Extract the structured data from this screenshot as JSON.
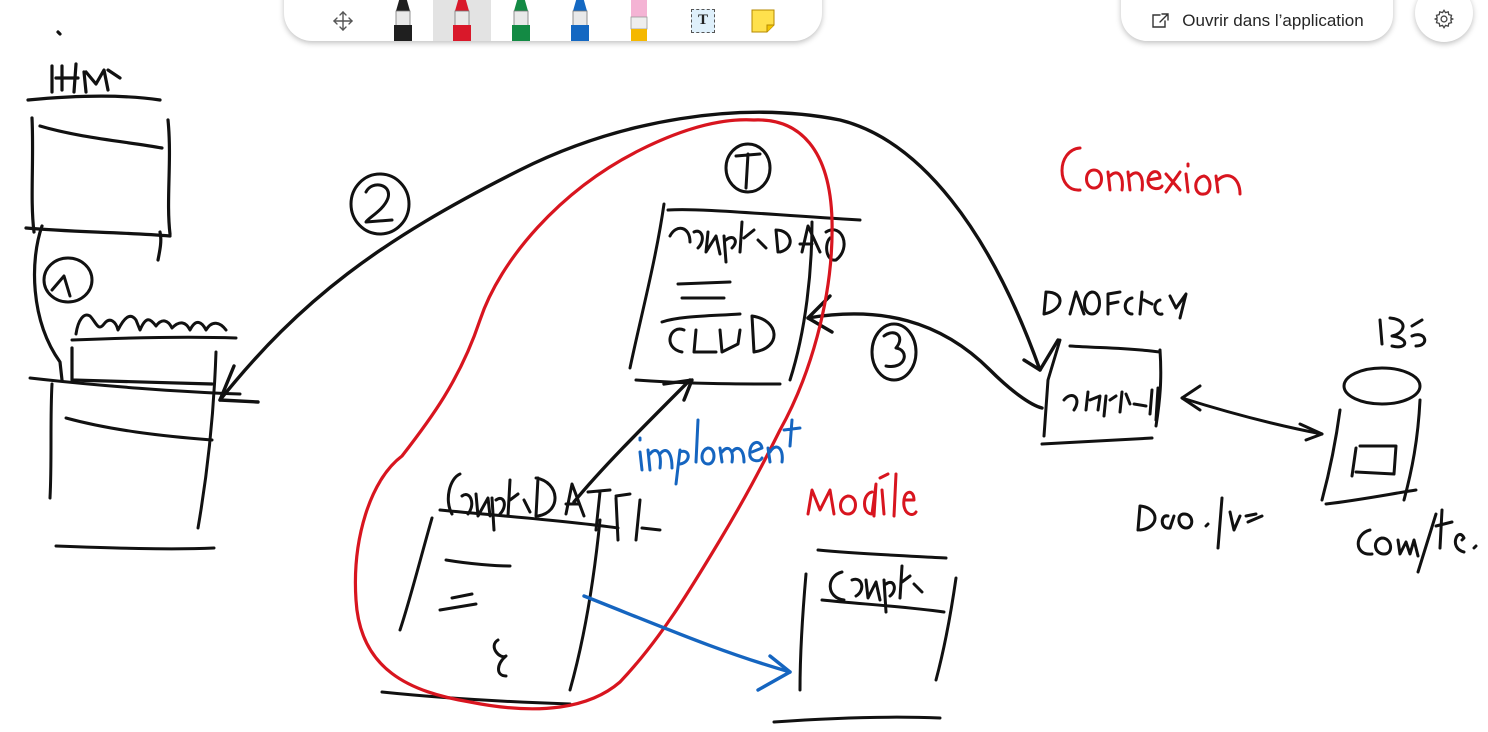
{
  "toolbar": {
    "tools": [
      {
        "name": "move-tool",
        "icon": "move-icon"
      },
      {
        "name": "pen-black",
        "icon": "pen-icon",
        "color": "#1f1f1f",
        "selected": false
      },
      {
        "name": "pen-red",
        "icon": "pen-icon",
        "color": "#d9182a",
        "selected": true
      },
      {
        "name": "pen-green",
        "icon": "pen-icon",
        "color": "#138a44",
        "selected": false
      },
      {
        "name": "pen-blue",
        "icon": "pen-icon",
        "color": "#1468c2",
        "selected": false
      },
      {
        "name": "highlighter-pink",
        "icon": "highlighter-icon",
        "color": "#f4b3d4",
        "selected": false
      },
      {
        "name": "text-tool",
        "icon": "text-box-icon",
        "glyph": "T"
      },
      {
        "name": "sticky-note",
        "icon": "sticky-note-icon",
        "color": "#ffe14d"
      }
    ]
  },
  "header": {
    "open_in_app_label": "Ouvrir dans l’application",
    "open_icon": "open-external-icon",
    "settings_icon": "gear-icon"
  },
  "ink_colors": {
    "black": "#111111",
    "red": "#d8151f",
    "blue": "#1565c0"
  }
}
